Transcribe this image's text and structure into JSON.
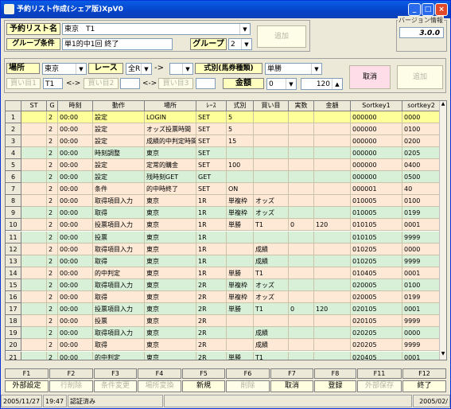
{
  "title": "予約リスト作成(シェア版)XpV0",
  "version_label": "バージョン情報",
  "version": "3.0.0",
  "list_name_label": "予約リスト名",
  "list_name_value": "東京　T1",
  "group_cond_label": "グループ条件",
  "group_cond_value": "単1的中1回 終了",
  "group_label": "グループ",
  "group_value": "2",
  "add_top": "追加",
  "place_label": "場所",
  "place_value": "東京",
  "race_label": "レース",
  "race_value": "全R",
  "arrow": "->",
  "race_to_value": "",
  "shiki_label": "式別(馬券種類)",
  "shiki_value": "単勝",
  "cancel_btn": "取消",
  "add_btn": "追加",
  "kaime1_label": "買い目1",
  "kaime1_value": "T1",
  "lr_arrow": "<->",
  "kaime2_label": "買い目2",
  "kaime3_label": "買い目3",
  "amount_label": "金額",
  "amount_from": "0",
  "amount_to": "120",
  "columns": [
    "",
    "ST",
    "G",
    "時刻",
    "動作",
    "場所",
    "ﾚｰｽ",
    "式別",
    "買い目",
    "実数",
    "金額",
    "Sortkey1",
    "sortkey2"
  ],
  "rows": [
    [
      "1",
      "",
      "2",
      "00:00",
      "設定",
      "LOGIN",
      "SET",
      "5",
      "",
      "",
      "",
      "000000",
      "0000"
    ],
    [
      "2",
      "",
      "2",
      "00:00",
      "設定",
      "オッズ投票時間",
      "SET",
      "5",
      "",
      "",
      "",
      "000000",
      "0100"
    ],
    [
      "3",
      "",
      "2",
      "00:00",
      "設定",
      "成績的中判定時間",
      "SET",
      "15",
      "",
      "",
      "",
      "000000",
      "0200"
    ],
    [
      "4",
      "",
      "2",
      "00:00",
      "時刻調整",
      "東京",
      "SET",
      "",
      "",
      "",
      "",
      "000000",
      "0205"
    ],
    [
      "5",
      "",
      "2",
      "00:00",
      "設定",
      "定常的購金",
      "SET",
      "100",
      "",
      "",
      "",
      "000000",
      "0400"
    ],
    [
      "6",
      "",
      "2",
      "00:00",
      "設定",
      "残時刻GET",
      "GET",
      "",
      "",
      "",
      "",
      "000000",
      "0500"
    ],
    [
      "7",
      "",
      "2",
      "00:00",
      "条件",
      "的中時終了",
      "SET",
      "ON",
      "",
      "",
      "",
      "000001",
      "40"
    ],
    [
      "8",
      "",
      "2",
      "00:00",
      "取得項目入力",
      "東京",
      "1R",
      "単複枠",
      "オッズ",
      "",
      "",
      "010005",
      "0100"
    ],
    [
      "9",
      "",
      "2",
      "00:00",
      "取得",
      "東京",
      "1R",
      "単複枠",
      "オッズ",
      "",
      "",
      "010005",
      "0199"
    ],
    [
      "10",
      "",
      "2",
      "00:00",
      "投票項目入力",
      "東京",
      "1R",
      "単勝",
      "T1",
      "0",
      "120",
      "010105",
      "0001"
    ],
    [
      "11",
      "",
      "2",
      "00:00",
      "投票",
      "東京",
      "1R",
      "",
      "",
      "",
      "",
      "010105",
      "9999"
    ],
    [
      "12",
      "",
      "2",
      "00:00",
      "取得項目入力",
      "東京",
      "1R",
      "",
      "成績",
      "",
      "",
      "010205",
      "0000"
    ],
    [
      "13",
      "",
      "2",
      "00:00",
      "取得",
      "東京",
      "1R",
      "",
      "成績",
      "",
      "",
      "010205",
      "9999"
    ],
    [
      "14",
      "",
      "2",
      "00:00",
      "的中判定",
      "東京",
      "1R",
      "単勝",
      "T1",
      "",
      "",
      "010405",
      "0001"
    ],
    [
      "15",
      "",
      "2",
      "00:00",
      "取得項目入力",
      "東京",
      "2R",
      "単複枠",
      "オッズ",
      "",
      "",
      "020005",
      "0100"
    ],
    [
      "16",
      "",
      "2",
      "00:00",
      "取得",
      "東京",
      "2R",
      "単複枠",
      "オッズ",
      "",
      "",
      "020005",
      "0199"
    ],
    [
      "17",
      "",
      "2",
      "00:00",
      "投票項目入力",
      "東京",
      "2R",
      "単勝",
      "T1",
      "0",
      "120",
      "020105",
      "0001"
    ],
    [
      "18",
      "",
      "2",
      "00:00",
      "投票",
      "東京",
      "2R",
      "",
      "",
      "",
      "",
      "020105",
      "9999"
    ],
    [
      "19",
      "",
      "2",
      "00:00",
      "取得項目入力",
      "東京",
      "2R",
      "",
      "成績",
      "",
      "",
      "020205",
      "0000"
    ],
    [
      "20",
      "",
      "2",
      "00:00",
      "取得",
      "東京",
      "2R",
      "",
      "成績",
      "",
      "",
      "020205",
      "9999"
    ],
    [
      "21",
      "",
      "2",
      "00:00",
      "的中判定",
      "東京",
      "2R",
      "単勝",
      "T1",
      "",
      "",
      "020405",
      "0001"
    ]
  ],
  "fkeys": [
    "F1",
    "F2",
    "F3",
    "F4",
    "F5",
    "F6",
    "F7",
    "F8",
    "F11",
    "F12"
  ],
  "fbuttons": [
    "外部設定",
    "行削除",
    "条件変更",
    "場所変換",
    "新規",
    "削除",
    "取消",
    "登録",
    "外部保存",
    "終了"
  ],
  "status_date": "2005/11/27",
  "status_time": "19:47",
  "status_auth": "認証済み",
  "status_right": "2005/02/"
}
